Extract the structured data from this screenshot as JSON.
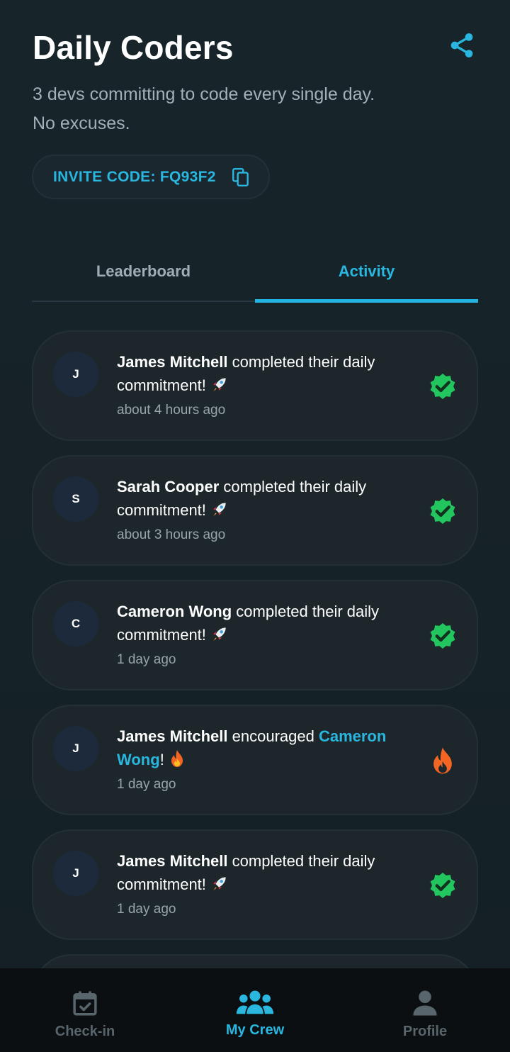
{
  "header": {
    "title": "Daily Coders",
    "subtitle_line1": "3 devs committing to code every single day.",
    "subtitle_line2": "No excuses.",
    "share_icon": "share-icon"
  },
  "invite": {
    "label": "INVITE CODE: ",
    "code": "FQ93F2",
    "copy_icon": "copy-icon"
  },
  "tabs": [
    {
      "label": "Leaderboard",
      "active": false
    },
    {
      "label": "Activity",
      "active": true
    }
  ],
  "activity": [
    {
      "initial": "J",
      "name": "James Mitchell",
      "action": " completed their daily commitment! ",
      "time": "about 4 hours ago",
      "icon": "verified-badge-icon"
    },
    {
      "initial": "S",
      "name": "Sarah Cooper",
      "action": " completed their daily commitment! ",
      "time": "about 3 hours ago",
      "icon": "verified-badge-icon"
    },
    {
      "initial": "C",
      "name": "Cameron Wong",
      "action": " completed their daily commitment! ",
      "time": "1 day ago",
      "icon": "verified-badge-icon"
    },
    {
      "initial": "J",
      "name": "James Mitchell",
      "action": " encouraged ",
      "target": "Cameron Wong",
      "suffix": "! ",
      "time": "1 day ago",
      "icon": "fire-icon"
    },
    {
      "initial": "J",
      "name": "James Mitchell",
      "action": " completed their daily commitment! ",
      "time": "1 day ago",
      "icon": "verified-badge-icon"
    }
  ],
  "nav": [
    {
      "label": "Check-in",
      "icon": "calendar-check-icon",
      "active": false
    },
    {
      "label": "My Crew",
      "icon": "group-icon",
      "active": true
    },
    {
      "label": "Profile",
      "icon": "person-icon",
      "active": false
    }
  ],
  "colors": {
    "background": "#152127",
    "accent": "#29b6df",
    "card": "#1c262b",
    "success": "#22c55e",
    "fire": "#f26522"
  }
}
